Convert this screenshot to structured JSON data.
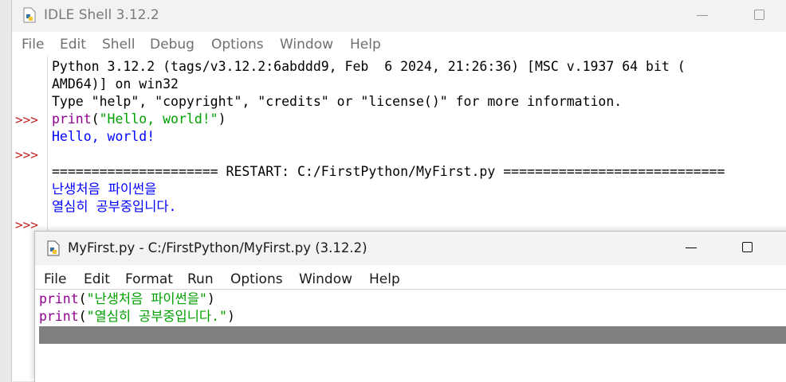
{
  "shell": {
    "title": "IDLE Shell 3.12.2",
    "menu": [
      "File",
      "Edit",
      "Shell",
      "Debug",
      "Options",
      "Window",
      "Help"
    ],
    "lines": {
      "banner1": "Python 3.12.2 (tags/v3.12.2:6abddd9, Feb  6 2024, 21:26:36) [MSC v.1937 64 bit (",
      "banner2": "AMD64)] on win32",
      "banner3": "Type \"help\", \"copyright\", \"credits\" or \"license()\" for more information.",
      "cmd_kw": "print",
      "cmd_open": "(",
      "cmd_str": "\"Hello, world!\"",
      "cmd_close": ")",
      "out1": "Hello, world!",
      "restart": "===================== RESTART: C:/FirstPython/MyFirst.py ============================",
      "out2": "난생처음 파이썬을",
      "out3": "열심히 공부중입니다."
    },
    "prompt": ">>>"
  },
  "editor": {
    "title": "MyFirst.py - C:/FirstPython/MyFirst.py (3.12.2)",
    "menu": [
      "File",
      "Edit",
      "Format",
      "Run",
      "Options",
      "Window",
      "Help"
    ],
    "code": [
      {
        "kw": "print",
        "open": "(",
        "str": "\"난생처음 파이썬을\"",
        "close": ")"
      },
      {
        "kw": "print",
        "open": "(",
        "str": "\"열심히 공부중입니다.\"",
        "close": ")"
      }
    ]
  },
  "icons": {
    "shell_icon": "python-file-icon",
    "editor_icon": "python-file-icon",
    "minimize": "minimize-icon",
    "maximize": "maximize-icon"
  },
  "colors": {
    "keyword": "#900090",
    "string": "#00a000",
    "output": "#0000ff",
    "prompt": "#c31f1f"
  }
}
